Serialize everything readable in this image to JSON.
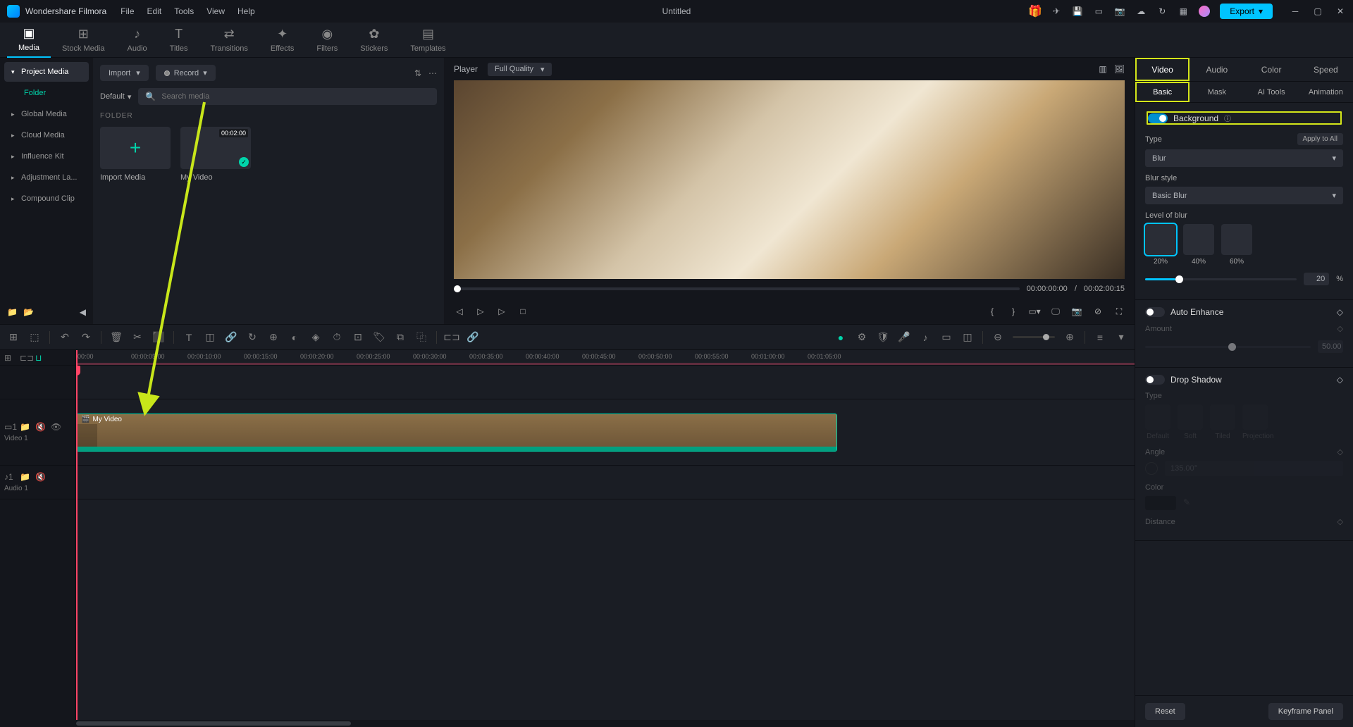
{
  "app": {
    "name": "Wondershare Filmora",
    "doc": "Untitled"
  },
  "menu": [
    "File",
    "Edit",
    "Tools",
    "View",
    "Help"
  ],
  "export_label": "Export",
  "top_tabs": [
    {
      "label": "Media",
      "active": true
    },
    {
      "label": "Stock Media"
    },
    {
      "label": "Audio"
    },
    {
      "label": "Titles"
    },
    {
      "label": "Transitions"
    },
    {
      "label": "Effects"
    },
    {
      "label": "Filters"
    },
    {
      "label": "Stickers"
    },
    {
      "label": "Templates"
    }
  ],
  "sidebar": {
    "items": [
      {
        "label": "Project Media",
        "active": true
      },
      {
        "label": "Folder",
        "sub": true
      },
      {
        "label": "Global Media"
      },
      {
        "label": "Cloud Media"
      },
      {
        "label": "Influence Kit"
      },
      {
        "label": "Adjustment La..."
      },
      {
        "label": "Compound Clip"
      }
    ]
  },
  "media": {
    "import_label": "Import",
    "record_label": "Record",
    "default_label": "Default",
    "search_placeholder": "Search media",
    "folder_label": "FOLDER",
    "import_media_label": "Import Media",
    "video_name": "My Video",
    "video_duration": "00:02:00"
  },
  "player": {
    "label": "Player",
    "quality": "Full Quality",
    "current": "00:00:00:00",
    "total": "00:02:00:15",
    "sep": "/"
  },
  "timeline": {
    "ticks": [
      "00:00",
      "00:00:05:00",
      "00:00:10:00",
      "00:00:15:00",
      "00:00:20:00",
      "00:00:25:00",
      "00:00:30:00",
      "00:00:35:00",
      "00:00:40:00",
      "00:00:45:00",
      "00:00:50:00",
      "00:00:55:00",
      "00:01:00:00",
      "00:01:05:00"
    ],
    "video_track": "Video 1",
    "audio_track": "Audio 1",
    "clip_name": "My Video"
  },
  "props": {
    "tabs": [
      "Video",
      "Audio",
      "Color",
      "Speed"
    ],
    "subtabs": [
      "Basic",
      "Mask",
      "AI Tools",
      "Animation"
    ],
    "background": {
      "title": "Background",
      "type_label": "Type",
      "apply_all": "Apply to All",
      "type_value": "Blur",
      "style_label": "Blur style",
      "style_value": "Basic Blur",
      "level_label": "Level of blur",
      "levels": [
        "20%",
        "40%",
        "60%"
      ],
      "slider_val": "20",
      "slider_unit": "%"
    },
    "auto_enhance": {
      "title": "Auto Enhance",
      "amount_label": "Amount",
      "amount_val": "50.00"
    },
    "drop_shadow": {
      "title": "Drop Shadow",
      "type_label": "Type",
      "types": [
        "Default",
        "Soft",
        "Tiled",
        "Projection"
      ],
      "angle_label": "Angle",
      "angle_val": "135.00°",
      "color_label": "Color",
      "distance_label": "Distance"
    },
    "reset": "Reset",
    "keyframe": "Keyframe Panel"
  }
}
